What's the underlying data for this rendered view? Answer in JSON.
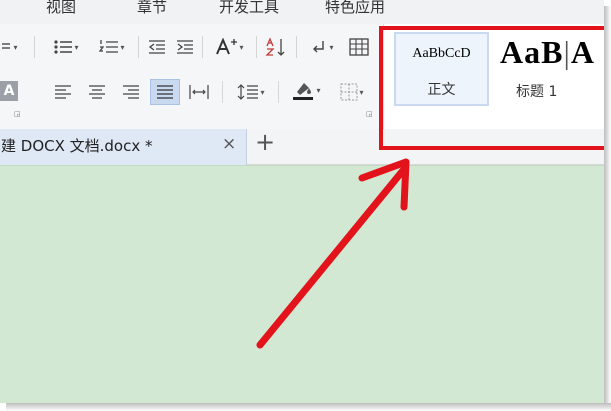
{
  "menu": {
    "items": [
      {
        "label": "视图"
      },
      {
        "label": "章节"
      },
      {
        "label": "开发工具"
      },
      {
        "label": "特色应用"
      }
    ]
  },
  "ribbon": {
    "paragraph_tools": [
      "bullet-list-icon",
      "numbered-list-icon",
      "decrease-indent-icon",
      "increase-indent-icon",
      "change-case-icon",
      "sort-icon",
      "show-marks-icon",
      "table-icon",
      "align-left-icon",
      "align-center-icon",
      "align-right-icon",
      "justify-icon",
      "distribute-icon",
      "line-spacing-icon",
      "shading-icon",
      "borders-icon"
    ],
    "partial_label": "A",
    "styles_gallery": {
      "styles": [
        {
          "sample": "AaBbCcD",
          "name": "正文",
          "selected": true
        },
        {
          "sample": "AaB",
          "name": "标题 1",
          "selected": false
        }
      ],
      "next_sample_partial": "A"
    }
  },
  "tabs": {
    "document_tab": {
      "title": "建 DOCX 文档.docx *"
    },
    "close_label": "×",
    "new_tab_label": "+"
  },
  "colors": {
    "highlight": "#e3131b",
    "workspace": "#d3e8d2",
    "tab_active": "#dfe8f5"
  }
}
